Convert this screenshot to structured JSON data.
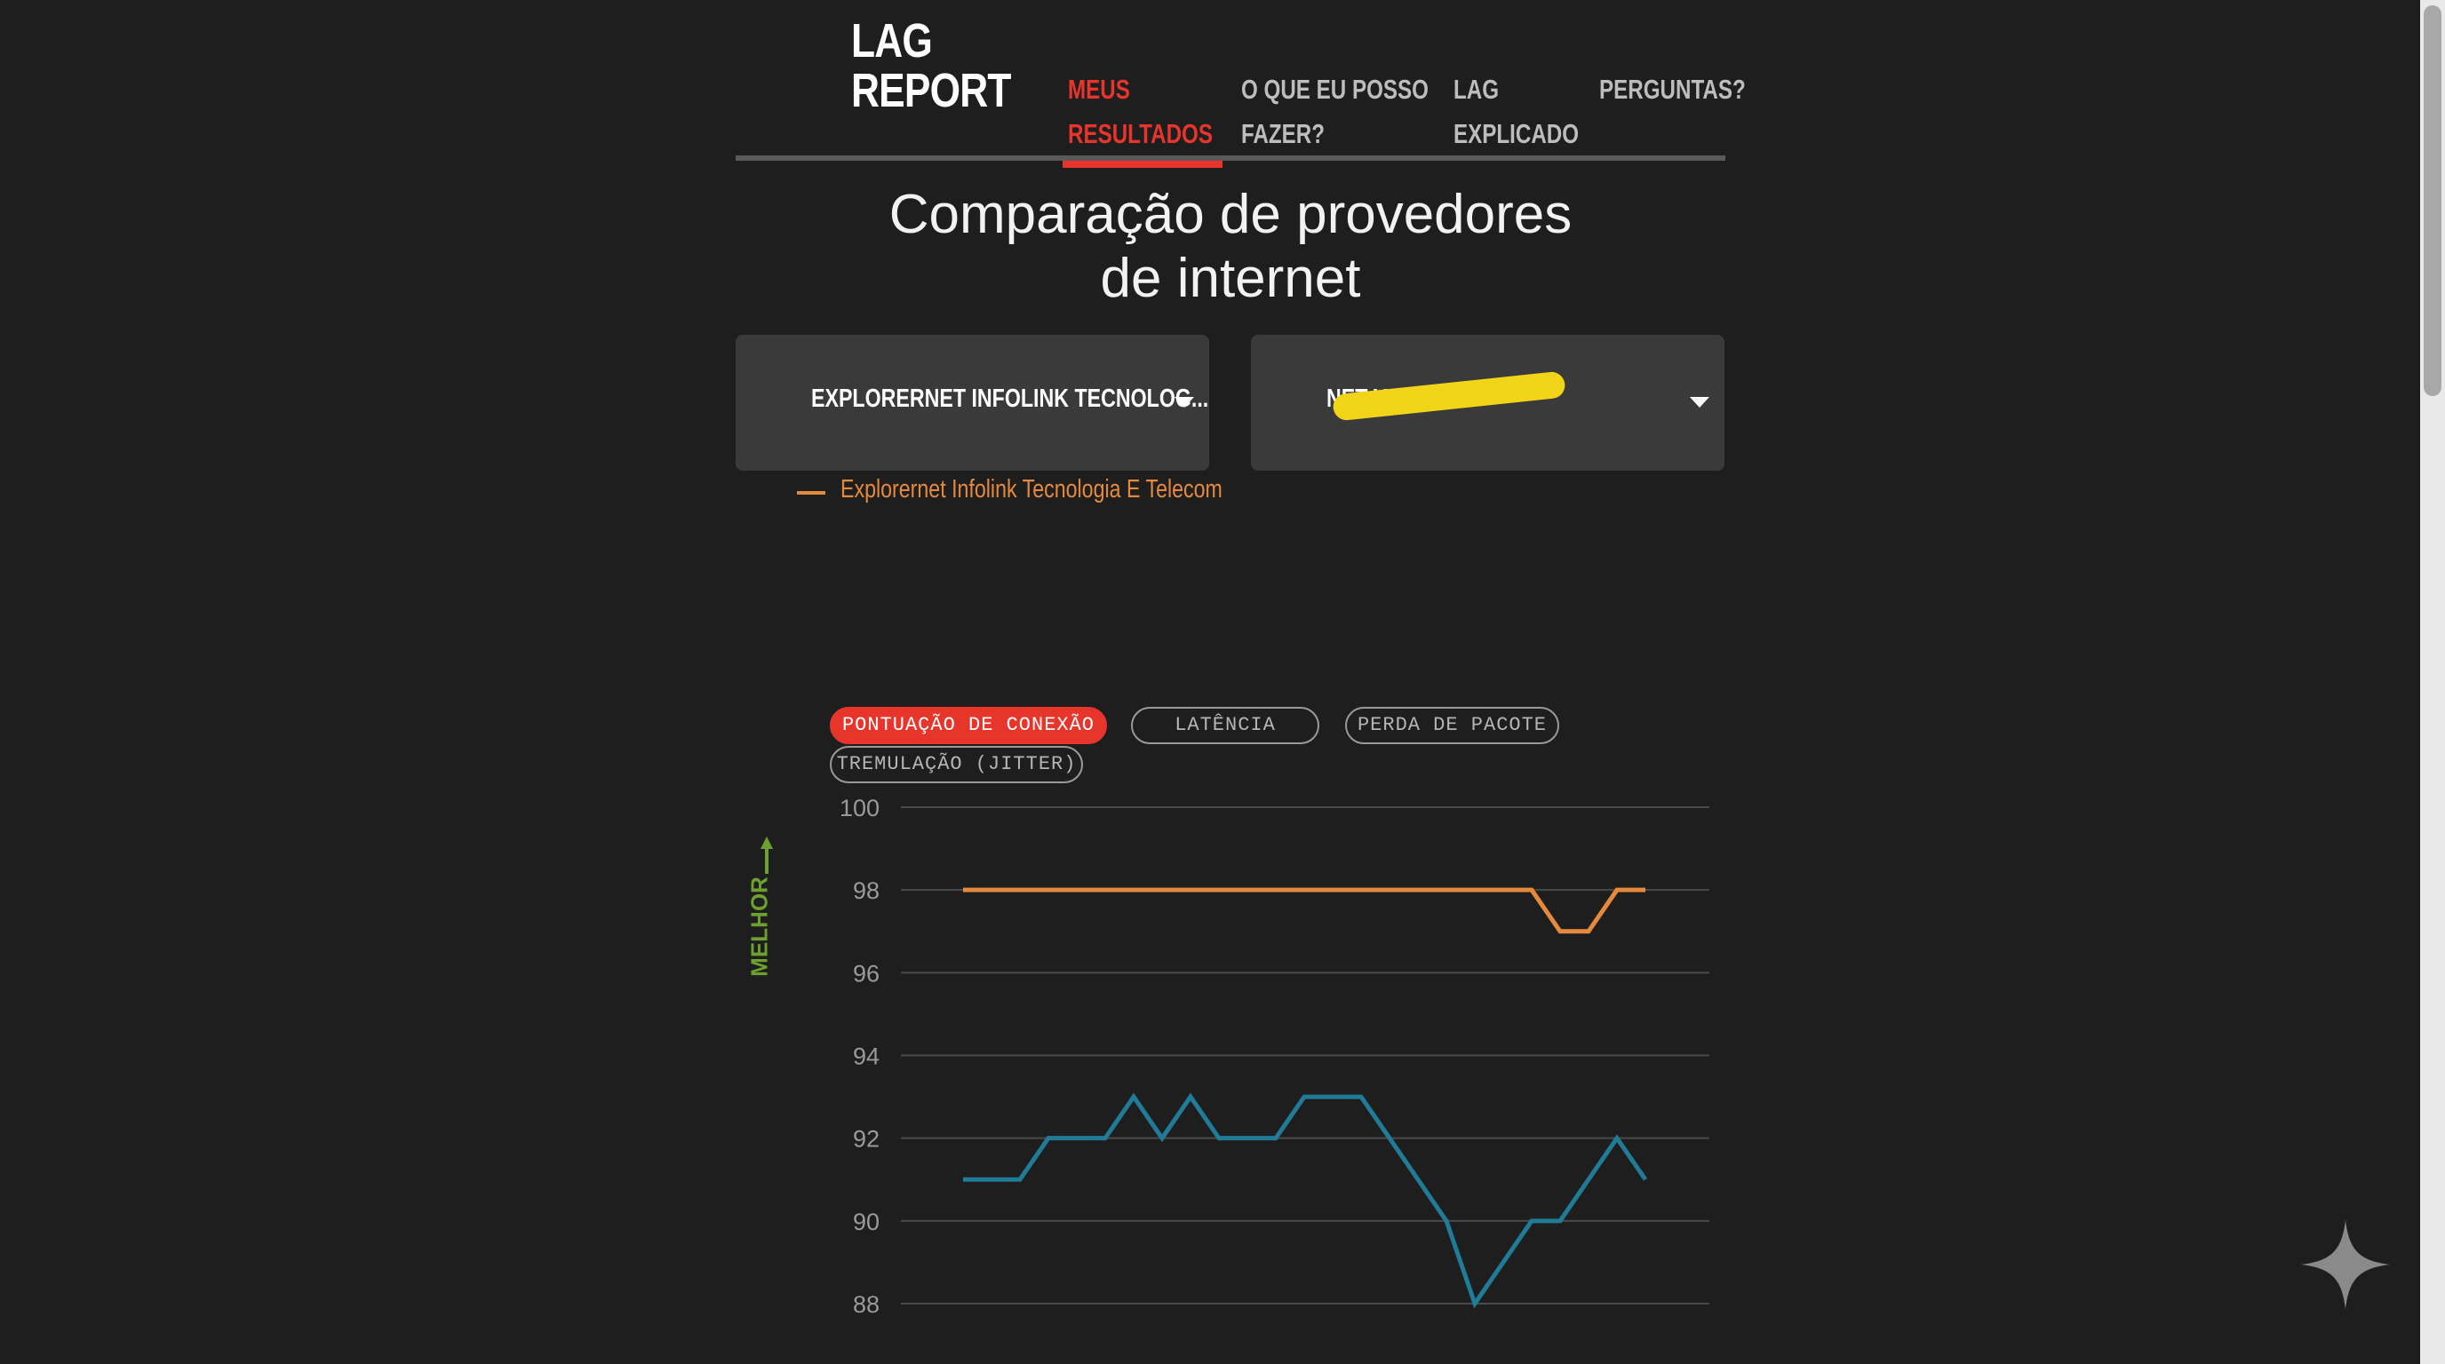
{
  "header": {
    "logo_line1": "LAG",
    "logo_line2": "REPORT",
    "nav": [
      {
        "line1": "MEUS",
        "line2": "RESULTADOS",
        "active": true
      },
      {
        "line1": "O QUE EU POSSO",
        "line2": "FAZER?"
      },
      {
        "line1": "LAG",
        "line2": "EXPLICADO"
      },
      {
        "line1": "PERGUNTAS?",
        "line2": ""
      }
    ]
  },
  "page": {
    "title_line1": "Comparação de provedores",
    "title_line2": "de internet"
  },
  "selectors": {
    "provider1": "EXPLORERNET INFOLINK TECNOLOG...",
    "provider2": "NET VIRTU"
  },
  "colors": {
    "accent": "#e8352c",
    "series_orange": "#e58a3c",
    "series_blue": "#1f7b96",
    "better": "#6da02f"
  },
  "tabs": [
    {
      "label": "PONTUAÇÃO DE CONEXÃO",
      "active": true
    },
    {
      "label": "LATÊNCIA"
    },
    {
      "label": "PERDA DE PACOTE"
    },
    {
      "label": "TREMULAÇÃO (JITTER)"
    }
  ],
  "chart_data": {
    "type": "line",
    "ylabel": "MELHOR",
    "ylim": [
      88,
      100
    ],
    "yticks": [
      100,
      98,
      96,
      94,
      92,
      90,
      88
    ],
    "grid": true,
    "legend_placement": "top-left",
    "x": [
      0,
      1,
      2,
      3,
      4,
      5,
      6,
      7,
      8,
      9,
      10,
      11,
      12,
      13,
      14,
      15,
      16,
      17,
      18,
      19,
      20,
      21,
      22,
      23,
      24
    ],
    "series": [
      {
        "name": "Explorernet Infolink Tecnologia E Telecom",
        "color": "#e58a3c",
        "values": [
          98,
          98,
          98,
          98,
          98,
          98,
          98,
          98,
          98,
          98,
          98,
          98,
          98,
          98,
          98,
          98,
          98,
          98,
          98,
          98,
          98,
          97,
          97,
          98,
          98
        ]
      },
      {
        "color": "#1f7b96",
        "values": [
          91,
          91,
          91,
          92,
          92,
          92,
          93,
          92,
          93,
          92,
          92,
          92,
          93,
          93,
          93,
          92,
          91,
          90,
          88,
          89,
          90,
          90,
          91,
          92,
          91
        ]
      }
    ]
  }
}
